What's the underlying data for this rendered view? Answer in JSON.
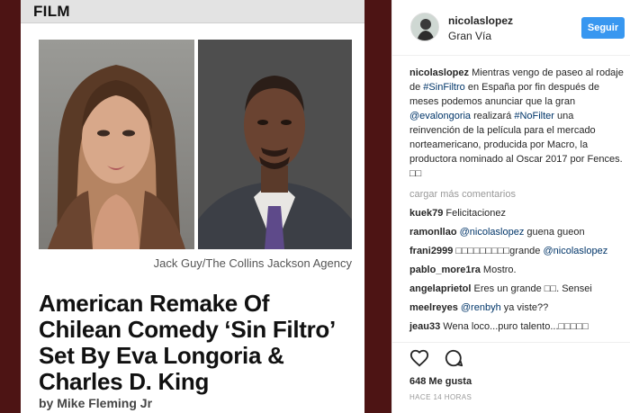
{
  "article": {
    "section": "FILM",
    "credit": "Jack Guy/The Collins Jackson Agency",
    "headline": "American Remake Of Chilean Comedy ‘Sin Filtro’ Set By Eva Longoria & Charles D. King",
    "byline": "by Mike Fleming Jr"
  },
  "post": {
    "username": "nicolaslopez",
    "location": "Gran Vía",
    "follow_label": "Seguir",
    "caption": {
      "user": "nicolaslopez",
      "t1": " Mientras vengo de paseo al rodaje de ",
      "tag1": "#SinFiltro",
      "t2": " en España por fin después de meses podemos anunciar que la gran ",
      "tag2": "@evalongoria",
      "t3": " realizará ",
      "tag3": "#NoFilter",
      "t4": " una reinvención de la película para el mercado norteamericano, producida por Macro, la productora nominado al Oscar 2017 por Fences. □□"
    },
    "load_more": "cargar más comentarios",
    "comments": [
      {
        "user": "kuek79",
        "pre": " Felicitacionez",
        "tag": "",
        "post": ""
      },
      {
        "user": "ramonllao",
        "pre": " ",
        "tag": "@nicolaslopez",
        "post": " guena gueon"
      },
      {
        "user": "frani2999",
        "pre": " □□□□□□□□□grande ",
        "tag": "@nicolaslopez",
        "post": ""
      },
      {
        "user": "pablo_more1ra",
        "pre": " Mostro.",
        "tag": "",
        "post": ""
      },
      {
        "user": "angelaprietol",
        "pre": " Eres un grande □□. Sensei",
        "tag": "",
        "post": ""
      },
      {
        "user": "meelreyes",
        "pre": " ",
        "tag": "@renbyh",
        "post": " ya viste??"
      },
      {
        "user": "jeau33",
        "pre": " Wena loco...puro talento...□□□□□",
        "tag": "",
        "post": ""
      }
    ],
    "likes": "648 Me gusta",
    "time": "HACE 14 HORAS"
  },
  "icons": {
    "like": "heart-icon",
    "comment": "speech-bubble-icon"
  },
  "colors": {
    "follow_button": "#3897f0",
    "tag_link": "#003569",
    "media_frame": "#4d1414"
  }
}
